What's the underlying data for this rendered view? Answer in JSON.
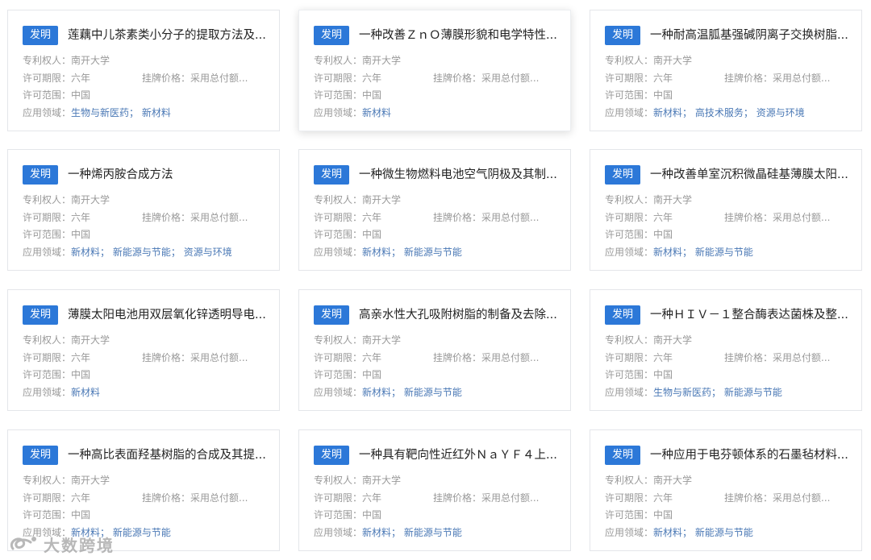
{
  "labels": {
    "badge": "发明",
    "owner": "专利权人：",
    "term": "许可期限：",
    "price": "挂牌价格：",
    "scope": "许可范围：",
    "field": "应用领域："
  },
  "colors": {
    "badge_bg": "#2c78d8",
    "field_link": "#4a78b5",
    "label_text": "#999999"
  },
  "cards": [
    {
      "title": "莲藕中儿茶素类小分子的提取方法及...",
      "owner": "南开大学",
      "term": "六年",
      "price": "采用总付额...",
      "scope": "中国",
      "fields": [
        "生物与新医药",
        "新材料"
      ]
    },
    {
      "title": "一种改善ＺｎＯ薄膜形貌和电学特性...",
      "owner": "南开大学",
      "term": "六年",
      "price": "采用总付额...",
      "scope": "中国",
      "fields": [
        "新材料"
      ]
    },
    {
      "title": "一种耐高温胍基强碱阴离子交换树脂...",
      "owner": "南开大学",
      "term": "六年",
      "price": "采用总付额...",
      "scope": "中国",
      "fields": [
        "新材料",
        "高技术服务",
        "资源与环境"
      ]
    },
    {
      "title": "一种烯丙胺合成方法",
      "owner": "南开大学",
      "term": "六年",
      "price": "采用总付额...",
      "scope": "中国",
      "fields": [
        "新材料",
        "新能源与节能",
        "资源与环境"
      ]
    },
    {
      "title": "一种微生物燃料电池空气阴极及其制...",
      "owner": "南开大学",
      "term": "六年",
      "price": "采用总付额...",
      "scope": "中国",
      "fields": [
        "新材料",
        "新能源与节能"
      ]
    },
    {
      "title": "一种改善单室沉积微晶硅基薄膜太阳...",
      "owner": "南开大学",
      "term": "六年",
      "price": "采用总付额...",
      "scope": "中国",
      "fields": [
        "新材料",
        "新能源与节能"
      ]
    },
    {
      "title": "薄膜太阳电池用双层氧化锌透明导电...",
      "owner": "南开大学",
      "term": "六年",
      "price": "采用总付额...",
      "scope": "中国",
      "fields": [
        "新材料"
      ]
    },
    {
      "title": "高亲水性大孔吸附树脂的制备及去除...",
      "owner": "南开大学",
      "term": "六年",
      "price": "采用总付额...",
      "scope": "中国",
      "fields": [
        "新材料",
        "新能源与节能"
      ]
    },
    {
      "title": "一种ＨＩＶ－１整合酶表达菌株及整...",
      "owner": "南开大学",
      "term": "六年",
      "price": "采用总付额...",
      "scope": "中国",
      "fields": [
        "生物与新医药",
        "新能源与节能"
      ]
    },
    {
      "title": "一种高比表面羟基树脂的合成及其提...",
      "owner": "南开大学",
      "term": "六年",
      "price": "采用总付额...",
      "scope": "中国",
      "fields": [
        "新材料",
        "新能源与节能"
      ]
    },
    {
      "title": "一种具有靶向性近红外ＮａＹＦ４上...",
      "owner": "南开大学",
      "term": "六年",
      "price": "采用总付额...",
      "scope": "中国",
      "fields": [
        "新材料",
        "新能源与节能"
      ]
    },
    {
      "title": "一种应用于电芬顿体系的石墨毡材料...",
      "owner": "南开大学",
      "term": "六年",
      "price": "采用总付额...",
      "scope": "中国",
      "fields": [
        "新材料",
        "新能源与节能"
      ]
    }
  ],
  "active_card_index": 1,
  "watermark": {
    "text": "大数跨境",
    "icon": "swirl-logo-icon"
  }
}
